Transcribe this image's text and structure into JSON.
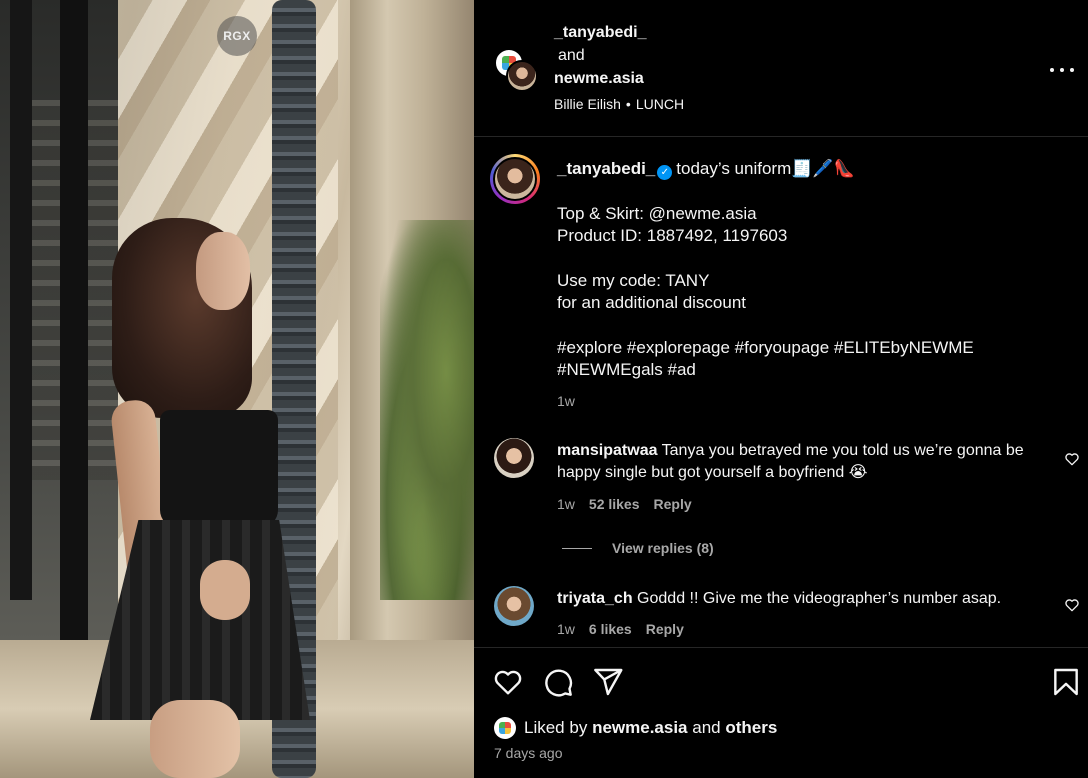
{
  "media": {
    "watermark": "RGX"
  },
  "header": {
    "user1": "_tanyabedi_",
    "and": "and",
    "user2": "newme.asia",
    "audio_artist": "Billie Eilish",
    "audio_separator": "•",
    "audio_track": "LUNCH",
    "more_icon": "more-horizontal-icon"
  },
  "caption": {
    "username": "_tanyabedi_",
    "verified_icon": "verified-badge-icon",
    "headline": "today’s uniform🧾🖊️👠",
    "line1": "Top & Skirt: @newme.asia",
    "line2": "Product ID: 1887492, 1197603",
    "line3": "Use my code: TANY",
    "line4": "for an additional discount",
    "line5": "#explore #explorepage #foryoupage #ELITEbyNEWME",
    "line6": "#NEWMEgals #ad",
    "time": "1w"
  },
  "comments": [
    {
      "username": "mansipatwaa",
      "text": "Tanya you betrayed me you told us we’re gonna be happy single but got yourself a boyfriend 😭",
      "time": "1w",
      "likes": "52 likes",
      "reply": "Reply",
      "view_replies": "View replies (8)"
    },
    {
      "username": "triyata_ch",
      "text": "Goddd !! Give me the videographer’s number asap.",
      "time": "1w",
      "likes": "6 likes",
      "reply": "Reply"
    }
  ],
  "actions": {
    "icons": [
      "heart-icon",
      "comment-icon",
      "share-icon",
      "bookmark-icon"
    ]
  },
  "likes": {
    "prefix": "Liked by",
    "user": "newme.asia",
    "and": "and",
    "others": "others"
  },
  "posted": "7 days ago",
  "colors": {
    "background": "#000000",
    "text": "#f5f5f5",
    "secondary": "#a8a8a8",
    "verified": "#0095f6",
    "divider": "#262626"
  }
}
